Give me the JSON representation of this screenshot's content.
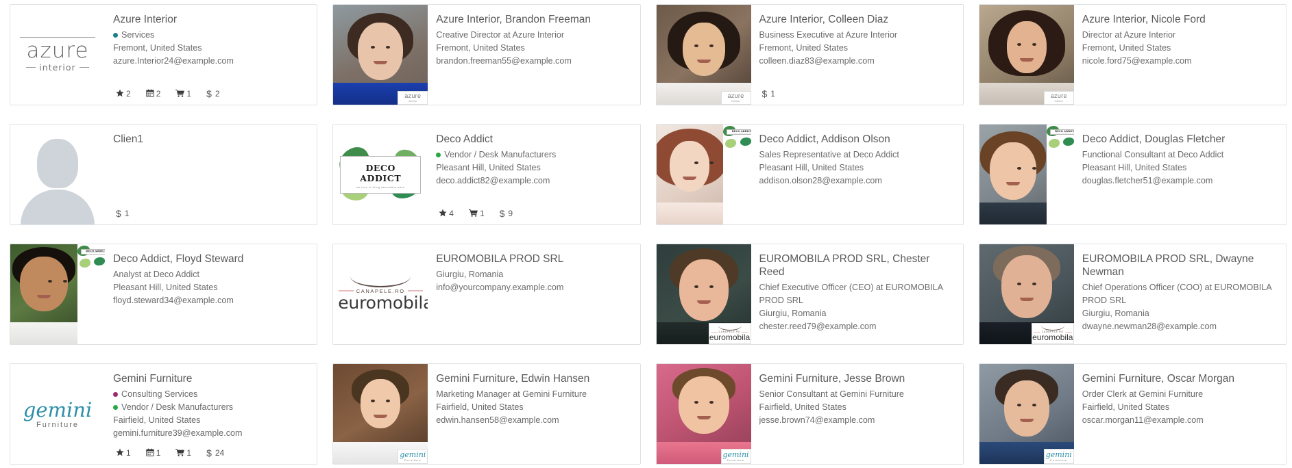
{
  "view": {
    "type": "kanban",
    "columns": 4,
    "rows": 4
  },
  "colors": {
    "tag_services": "#1f7e8c",
    "tag_vendor": "#28a745",
    "tag_consulting": "#9b2d6f",
    "card_border": "#dfe2e5",
    "title_text": "#5a5a5a",
    "body_text": "#6b6b6b"
  },
  "icons": {
    "star": "star-icon",
    "calendar": "calendar-icon",
    "cart": "shopping-cart-icon",
    "dollar": "dollar-icon"
  },
  "cards": [
    {
      "kind": "company",
      "media": "logo-azure",
      "title": "Azure Interior",
      "tags": [
        {
          "label": "Services",
          "color": "#1f7e8c"
        }
      ],
      "subtitle": "",
      "location": "Fremont, United States",
      "email": "azure.Interior24@example.com",
      "stats": [
        {
          "icon": "star-icon",
          "glyph": "★",
          "value": "2"
        },
        {
          "icon": "calendar-icon",
          "glyph": "Ὄ5",
          "value": "2"
        },
        {
          "icon": "shopping-cart-icon",
          "glyph": "🛒",
          "value": "1"
        },
        {
          "icon": "dollar-icon",
          "glyph": "$",
          "value": "2"
        }
      ]
    },
    {
      "kind": "person",
      "media": "photo-brandon",
      "badge": "azure",
      "title": "Azure Interior, Brandon Freeman",
      "tags": [],
      "subtitle": "Creative Director at Azure Interior",
      "location": "Fremont, United States",
      "email": "brandon.freeman55@example.com",
      "stats": []
    },
    {
      "kind": "person",
      "media": "photo-colleen",
      "badge": "azure",
      "title": "Azure Interior, Colleen Diaz",
      "tags": [],
      "subtitle": "Business Executive at Azure Interior",
      "location": "Fremont, United States",
      "email": "colleen.diaz83@example.com",
      "stats": [
        {
          "icon": "dollar-icon",
          "glyph": "$",
          "value": "1"
        }
      ]
    },
    {
      "kind": "person",
      "media": "photo-nicole",
      "badge": "azure",
      "title": "Azure Interior, Nicole Ford",
      "tags": [],
      "subtitle": "Director at Azure Interior",
      "location": "Fremont, United States",
      "email": "nicole.ford75@example.com",
      "stats": []
    },
    {
      "kind": "person",
      "media": "avatar-placeholder",
      "title": "Clien1",
      "tags": [],
      "subtitle": "",
      "location": "",
      "email": "",
      "stats": [
        {
          "icon": "dollar-icon",
          "glyph": "$",
          "value": "1"
        }
      ]
    },
    {
      "kind": "company",
      "media": "logo-deco",
      "title": "Deco Addict",
      "tags": [
        {
          "label": "Vendor / Desk Manufacturers",
          "color": "#28a745"
        }
      ],
      "subtitle": "",
      "location": "Pleasant Hill, United States",
      "email": "deco.addict82@example.com",
      "stats": [
        {
          "icon": "star-icon",
          "glyph": "★",
          "value": "4"
        },
        {
          "icon": "shopping-cart-icon",
          "glyph": "🛒",
          "value": "1"
        },
        {
          "icon": "dollar-icon",
          "glyph": "$",
          "value": "9"
        }
      ]
    },
    {
      "kind": "person",
      "media": "photo-addison",
      "badge": "deco",
      "title": "Deco Addict, Addison Olson",
      "tags": [],
      "subtitle": "Sales Representative at Deco Addict",
      "location": "Pleasant Hill, United States",
      "email": "addison.olson28@example.com",
      "stats": []
    },
    {
      "kind": "person",
      "media": "photo-douglas",
      "badge": "deco",
      "title": "Deco Addict, Douglas Fletcher",
      "tags": [],
      "subtitle": "Functional Consultant at Deco Addict",
      "location": "Pleasant Hill, United States",
      "email": "douglas.fletcher51@example.com",
      "stats": []
    },
    {
      "kind": "person",
      "media": "photo-floyd",
      "badge": "deco",
      "title": "Deco Addict, Floyd Steward",
      "tags": [],
      "subtitle": "Analyst at Deco Addict",
      "location": "Pleasant Hill, United States",
      "email": "floyd.steward34@example.com",
      "stats": []
    },
    {
      "kind": "company",
      "media": "logo-euro",
      "title": "EUROMOBILA PROD SRL",
      "tags": [],
      "subtitle": "",
      "location": "Giurgiu, Romania",
      "email": "info@yourcompany.example.com",
      "stats": []
    },
    {
      "kind": "person",
      "media": "photo-chester",
      "badge": "euro",
      "title": "EUROMOBILA PROD SRL, Chester Reed",
      "tags": [],
      "subtitle": "Chief Executive Officer (CEO) at EUROMOBILA PROD SRL",
      "location": "Giurgiu, Romania",
      "email": "chester.reed79@example.com",
      "stats": []
    },
    {
      "kind": "person",
      "media": "photo-dwayne",
      "badge": "euro",
      "title": "EUROMOBILA PROD SRL, Dwayne Newman",
      "tags": [],
      "subtitle": "Chief Operations Officer (COO) at EUROMOBILA PROD SRL",
      "location": "Giurgiu, Romania",
      "email": "dwayne.newman28@example.com",
      "stats": []
    },
    {
      "kind": "company",
      "media": "logo-gem",
      "title": "Gemini Furniture",
      "tags": [
        {
          "label": "Consulting Services",
          "color": "#9b2d6f"
        },
        {
          "label": "Vendor / Desk Manufacturers",
          "color": "#28a745"
        }
      ],
      "subtitle": "",
      "location": "Fairfield, United States",
      "email": "gemini.furniture39@example.com",
      "stats": [
        {
          "icon": "star-icon",
          "glyph": "★",
          "value": "1"
        },
        {
          "icon": "calendar-icon",
          "glyph": "📅",
          "value": "1"
        },
        {
          "icon": "shopping-cart-icon",
          "glyph": "🛒",
          "value": "1"
        },
        {
          "icon": "dollar-icon",
          "glyph": "$",
          "value": "24"
        }
      ]
    },
    {
      "kind": "person",
      "media": "photo-edwin",
      "badge": "gem",
      "title": "Gemini Furniture, Edwin Hansen",
      "tags": [],
      "subtitle": "Marketing Manager at Gemini Furniture",
      "location": "Fairfield, United States",
      "email": "edwin.hansen58@example.com",
      "stats": []
    },
    {
      "kind": "person",
      "media": "photo-jesse",
      "badge": "gem",
      "title": "Gemini Furniture, Jesse Brown",
      "tags": [],
      "subtitle": "Senior Consultant at Gemini Furniture",
      "location": "Fairfield, United States",
      "email": "jesse.brown74@example.com",
      "stats": []
    },
    {
      "kind": "person",
      "media": "photo-oscar",
      "badge": "gem",
      "title": "Gemini Furniture, Oscar Morgan",
      "tags": [],
      "subtitle": "Order Clerk at Gemini Furniture",
      "location": "Fairfield, United States",
      "email": "oscar.morgan11@example.com",
      "stats": []
    }
  ],
  "logo_text": {
    "azure_word": "azure",
    "azure_sub": "interior",
    "deco_title": "DECO ADDICT",
    "deco_sub": "we love to bring decoration alive",
    "euro_cana": "CANAPELE.RO",
    "euro_name": "euromobila",
    "gem_g": "gemini",
    "gem_f": "Furniture"
  }
}
